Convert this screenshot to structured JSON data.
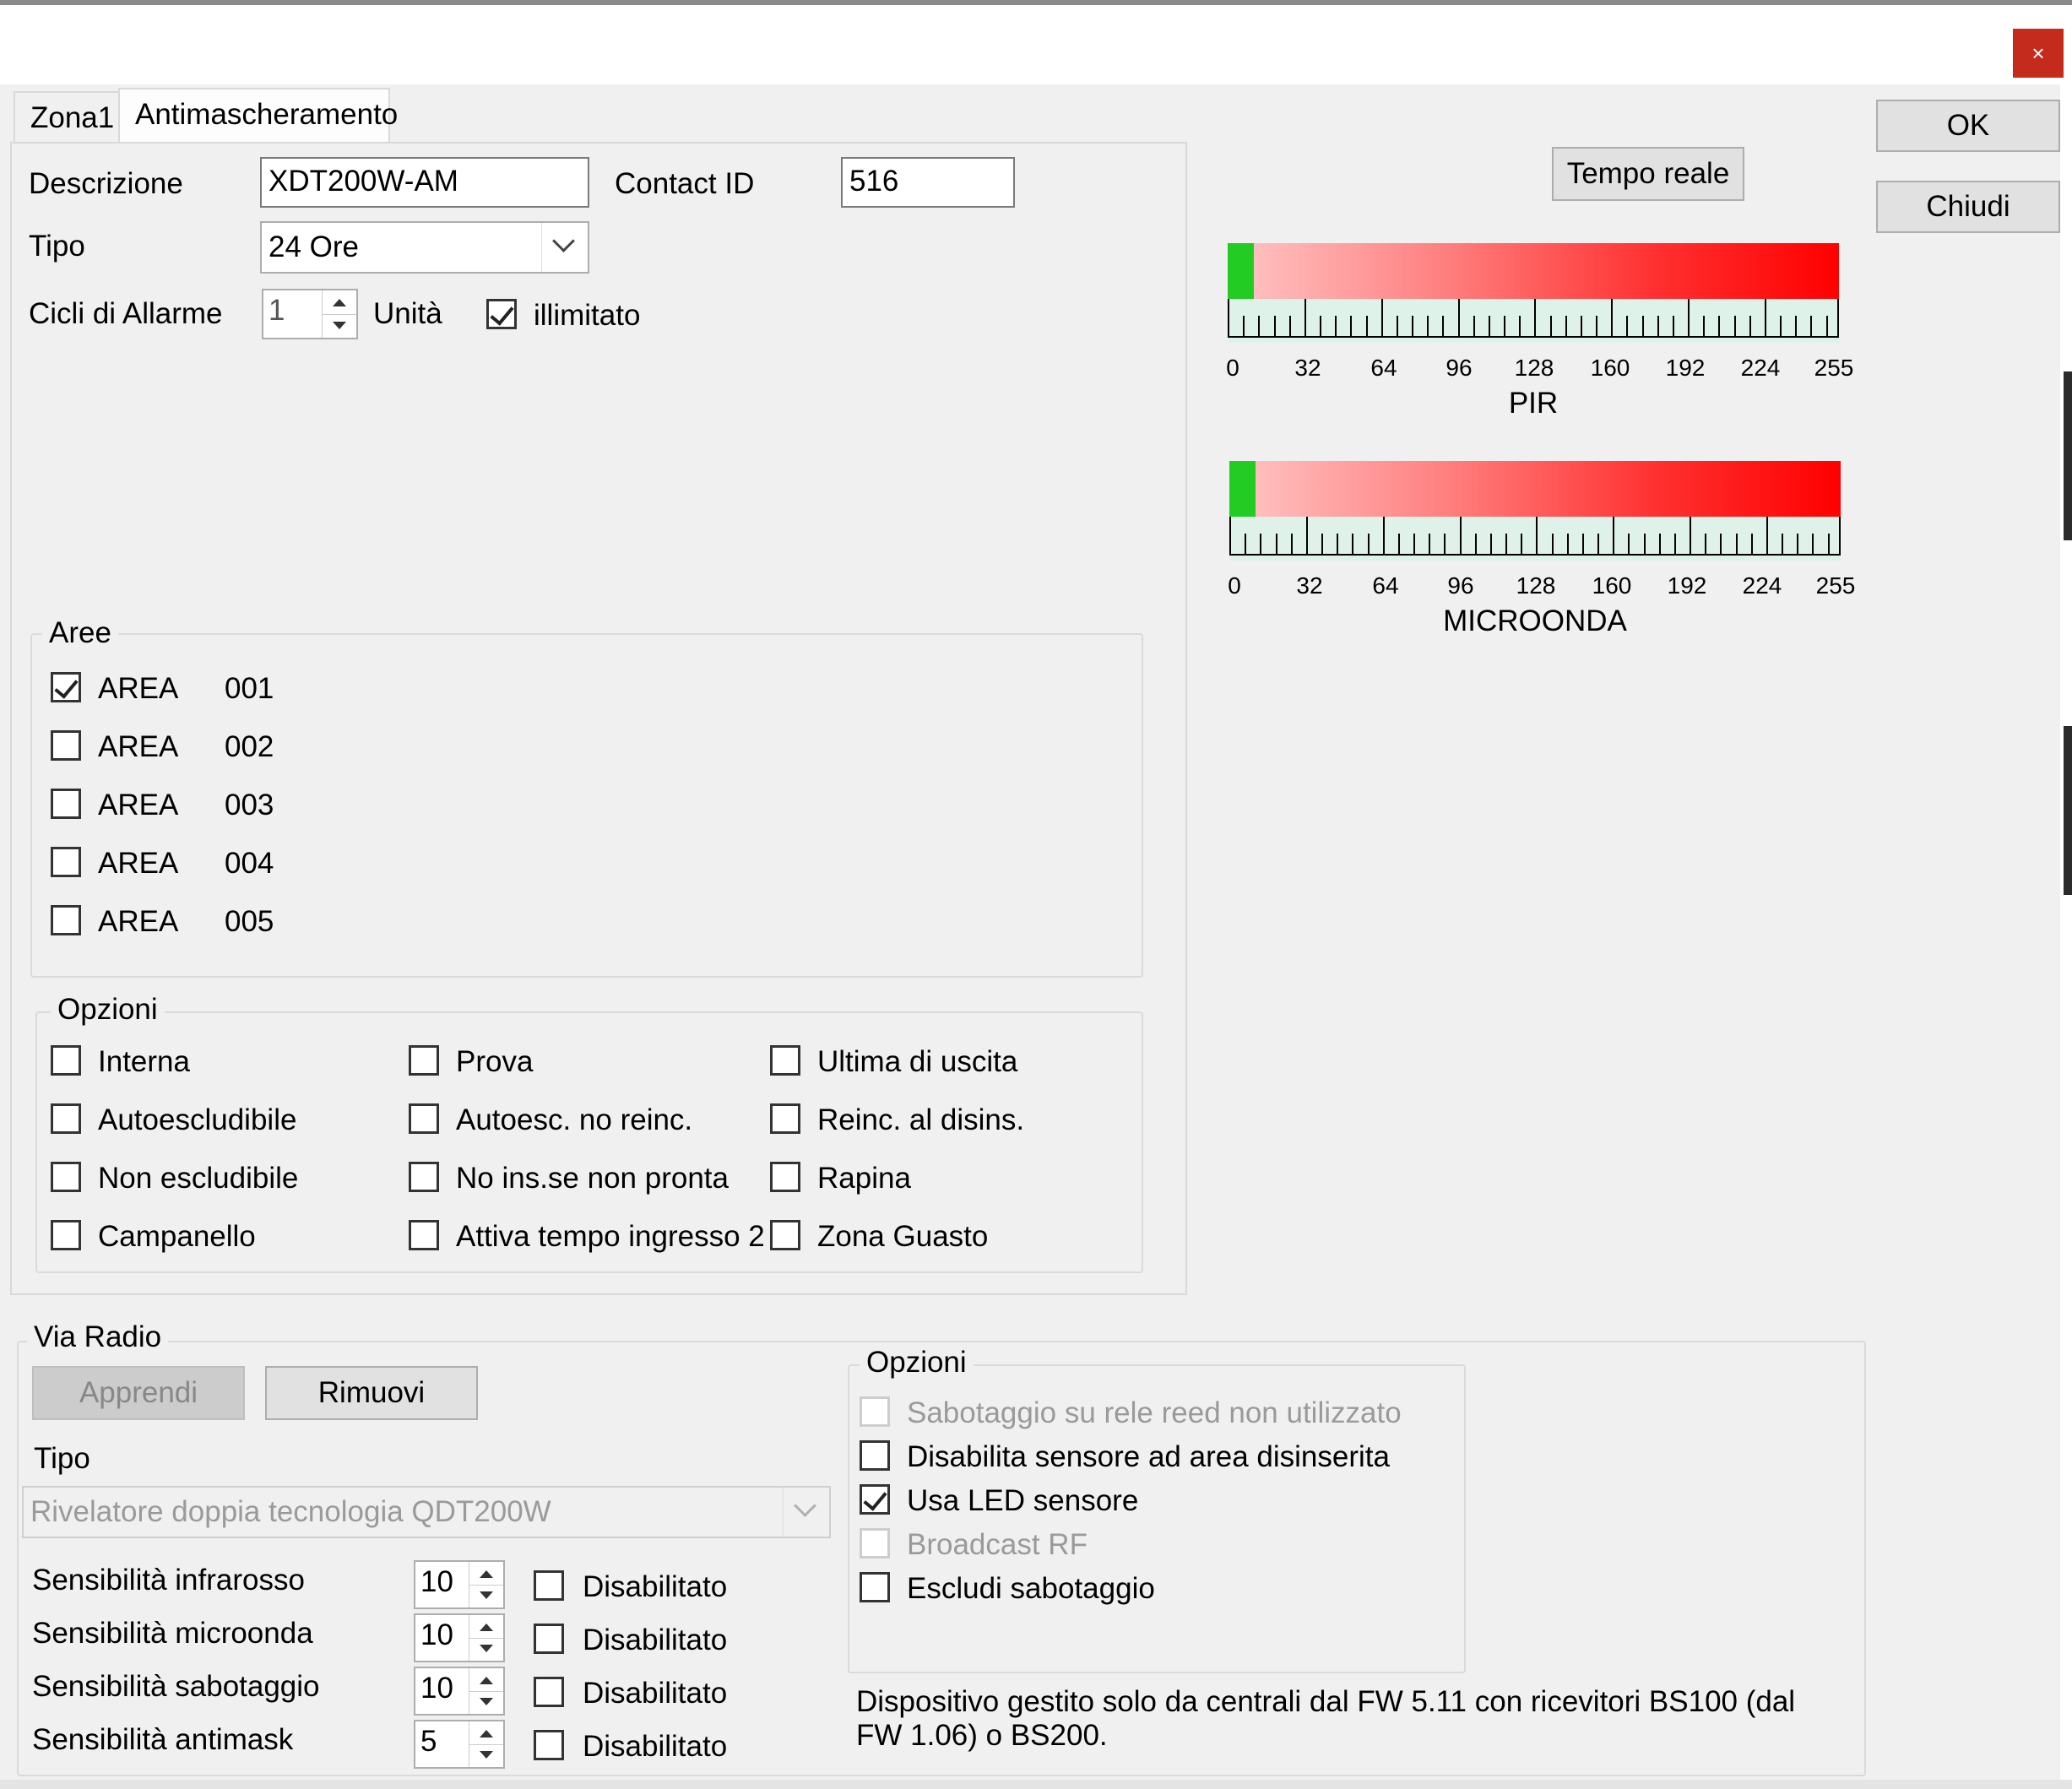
{
  "window": {
    "close_glyph": "×"
  },
  "tabs": [
    {
      "label": "Zona1"
    },
    {
      "label": "Antimascheramento"
    }
  ],
  "buttons": {
    "ok": "OK",
    "close": "Chiudi",
    "realtime": "Tempo reale"
  },
  "general": {
    "description_label": "Descrizione",
    "description_value": "XDT200W-AM",
    "contact_id_label": "Contact ID",
    "contact_id_value": "516",
    "type_label": "Tipo",
    "type_value": "24 Ore",
    "alarm_cycles_label": "Cicli di Allarme",
    "alarm_cycles_value": "1",
    "unit_label": "Unità",
    "unlimited_label": "illimitato",
    "unlimited_checked": true
  },
  "areas": {
    "title": "Aree",
    "items": [
      {
        "label": "AREA",
        "code": "001",
        "checked": true
      },
      {
        "label": "AREA",
        "code": "002",
        "checked": false
      },
      {
        "label": "AREA",
        "code": "003",
        "checked": false
      },
      {
        "label": "AREA",
        "code": "004",
        "checked": false
      },
      {
        "label": "AREA",
        "code": "005",
        "checked": false
      }
    ]
  },
  "options": {
    "title": "Opzioni",
    "items": [
      {
        "label": "Interna",
        "checked": false
      },
      {
        "label": "Prova",
        "checked": false
      },
      {
        "label": "Ultima di uscita",
        "checked": false
      },
      {
        "label": "Autoescludibile",
        "checked": false
      },
      {
        "label": "Autoesc. no reinc.",
        "checked": false
      },
      {
        "label": "Reinc. al disins.",
        "checked": false
      },
      {
        "label": "Non escludibile",
        "checked": false
      },
      {
        "label": "No ins.se non pronta",
        "checked": false
      },
      {
        "label": "Rapina",
        "checked": false
      },
      {
        "label": "Campanello",
        "checked": false
      },
      {
        "label": "Attiva tempo ingresso 2",
        "checked": false
      },
      {
        "label": "Zona Guasto",
        "checked": false
      }
    ]
  },
  "meters": [
    {
      "name": "PIR",
      "value": 6,
      "max": 255,
      "ticks": [
        "0",
        "32",
        "64",
        "96",
        "128",
        "160",
        "192",
        "224",
        "255"
      ]
    },
    {
      "name": "MICROONDA",
      "value": 6,
      "max": 255,
      "ticks": [
        "0",
        "32",
        "64",
        "96",
        "128",
        "160",
        "192",
        "224",
        "255"
      ]
    }
  ],
  "radio": {
    "title": "Via Radio",
    "learn_label": "Apprendi",
    "remove_label": "Rimuovi",
    "type_label": "Tipo",
    "type_value": "Rivelatore doppia tecnologia QDT200W",
    "sensitivities": [
      {
        "label": "Sensibilità infrarosso",
        "value": "10",
        "disabled_label": "Disabilitato",
        "checked": false
      },
      {
        "label": "Sensibilità microonda",
        "value": "10",
        "disabled_label": "Disabilitato",
        "checked": false
      },
      {
        "label": "Sensibilità sabotaggio",
        "value": "10",
        "disabled_label": "Disabilitato",
        "checked": false
      },
      {
        "label": "Sensibilità antimask",
        "value": "5",
        "disabled_label": "Disabilitato",
        "checked": false
      }
    ],
    "options": {
      "title": "Opzioni",
      "items": [
        {
          "label": "Sabotaggio su rele reed non utilizzato",
          "checked": false,
          "enabled": false
        },
        {
          "label": "Disabilita sensore ad area disinserita",
          "checked": false,
          "enabled": true
        },
        {
          "label": "Usa LED sensore",
          "checked": true,
          "enabled": true
        },
        {
          "label": "Broadcast RF",
          "checked": false,
          "enabled": false
        },
        {
          "label": "Escludi sabotaggio",
          "checked": false,
          "enabled": true
        }
      ]
    },
    "note": "Dispositivo gestito solo da centrali dal FW 5.11 con ricevitori BS100 (dal FW 1.06) o BS200."
  },
  "colors": {
    "accent_close": "#c42b1c",
    "meter_low": "#22cc22",
    "meter_high": "#ff0000"
  }
}
